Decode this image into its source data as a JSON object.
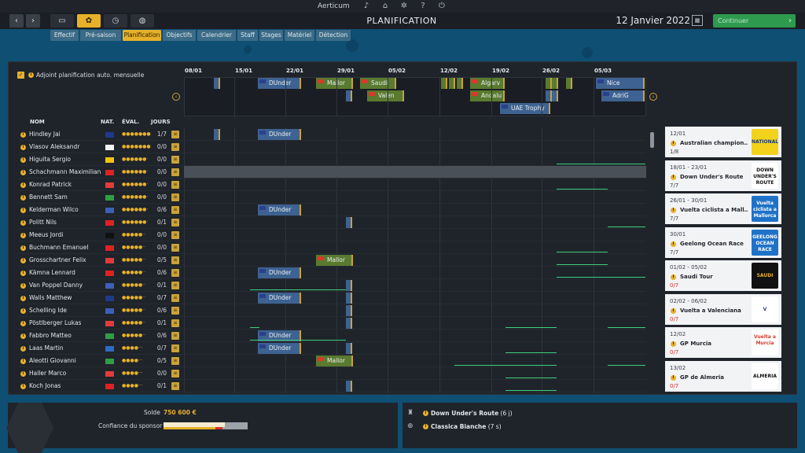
{
  "app": {
    "title": "Aerticum"
  },
  "header": {
    "page_title": "PLANIFICATION",
    "date": "12 Janvier 2022",
    "continue_label": "Continuer"
  },
  "tabs": [
    {
      "label": "Effectif"
    },
    {
      "label": "Pré-saison"
    },
    {
      "label": "Planification"
    },
    {
      "label": "Objectifs"
    },
    {
      "label": "Calendrier"
    },
    {
      "label": "Staff"
    },
    {
      "label": "Stages"
    },
    {
      "label": "Matériel"
    },
    {
      "label": "Détection"
    }
  ],
  "active_tab": "Planification",
  "auto_plan": {
    "label": "Adjoint planification auto. mensuelle",
    "checked": true
  },
  "timeline": {
    "weeks": [
      "08/01",
      "15/01",
      "22/01",
      "29/01",
      "05/02",
      "12/02",
      "19/02",
      "26/02",
      "05/03"
    ],
    "races": [
      {
        "name": "DUnder"
      },
      {
        "name": "Mallor"
      },
      {
        "name": "Saudi"
      },
      {
        "name": "Valen"
      },
      {
        "name": "Algarv"
      },
      {
        "name": "Andalu"
      },
      {
        "name": "UAE Trophy"
      },
      {
        "name": "Nice"
      },
      {
        "name": "AdriG"
      }
    ]
  },
  "columns": {
    "name": "NOM",
    "nat": "NAT.",
    "eval": "ÉVAL.",
    "days": "JOURS"
  },
  "riders": [
    {
      "name": "Hindley Jai",
      "days": "1/7",
      "stars": 7
    },
    {
      "name": "Vlasov Aleksandr",
      "days": "0/0",
      "stars": 7
    },
    {
      "name": "Higuita Sergio",
      "days": "0/0",
      "stars": 6
    },
    {
      "name": "Schachmann Maximilian",
      "days": "0/0",
      "stars": 6
    },
    {
      "name": "Konrad Patrick",
      "days": "0/0",
      "stars": 6
    },
    {
      "name": "Bennett Sam",
      "days": "0/0",
      "stars": 6
    },
    {
      "name": "Kelderman Wilco",
      "days": "0/6",
      "stars": 6
    },
    {
      "name": "Politt Nils",
      "days": "0/1",
      "stars": 6
    },
    {
      "name": "Meeus Jordi",
      "days": "0/0",
      "stars": 5
    },
    {
      "name": "Buchmann Emanuel",
      "days": "0/0",
      "stars": 5
    },
    {
      "name": "Grosschartner Felix",
      "days": "0/5",
      "stars": 5
    },
    {
      "name": "Kämna Lennard",
      "days": "0/6",
      "stars": 5
    },
    {
      "name": "Van Poppel Danny",
      "days": "0/1",
      "stars": 5
    },
    {
      "name": "Walls Matthew",
      "days": "0/7",
      "stars": 5
    },
    {
      "name": "Schelling Ide",
      "days": "0/6",
      "stars": 5
    },
    {
      "name": "Pöstlberger Lukas",
      "days": "0/1",
      "stars": 5
    },
    {
      "name": "Fabbro Matteo",
      "days": "0/6",
      "stars": 5
    },
    {
      "name": "Laas Martin",
      "days": "0/7",
      "stars": 4
    },
    {
      "name": "Aleotti Giovanni",
      "days": "0/5",
      "stars": 4
    },
    {
      "name": "Haller Marco",
      "days": "0/0",
      "stars": 4
    },
    {
      "name": "Koch Jonas",
      "days": "0/1",
      "stars": 4
    }
  ],
  "right_races": [
    {
      "dates": "12/01",
      "name": "Australian champion…",
      "count": "1/8",
      "count_red": false,
      "logo": "NATIONAL"
    },
    {
      "dates": "18/01 - 23/01",
      "name": "Down Under's Route",
      "count": "7/7",
      "count_red": false,
      "logo": "DOWN UNDER'S ROUTE"
    },
    {
      "dates": "26/01 - 30/01",
      "name": "Vuelta ciclista a Mall…",
      "count": "7/7",
      "count_red": false,
      "logo": "Vuelta ciclista a Mallorca"
    },
    {
      "dates": "30/01",
      "name": "Geelong Ocean Race",
      "count": "7/7",
      "count_red": false,
      "logo": "GEELONG OCEAN RACE"
    },
    {
      "dates": "01/02 - 05/02",
      "name": "Saudi Tour",
      "count": "0/7",
      "count_red": true,
      "logo": "SAUDI TOUR"
    },
    {
      "dates": "02/02 - 06/02",
      "name": "Vuelta a Valenciana",
      "count": "0/7",
      "count_red": true,
      "logo": "V"
    },
    {
      "dates": "12/02",
      "name": "GP Murcia",
      "count": "0/7",
      "count_red": true,
      "logo": "Vuelta a Murcia"
    },
    {
      "dates": "13/02",
      "name": "GP de Almeria",
      "count": "0/7",
      "count_red": true,
      "logo": "ALMERIA"
    }
  ],
  "finance": {
    "solde_label": "Solde",
    "solde_value": "750 600 €",
    "sponsor_label": "Confiance du sponsor",
    "sponsor_level": 0.73
  },
  "objectives": [
    {
      "race": "Down Under's Route",
      "detail": "(6 j)"
    },
    {
      "race": "Classica Bianche",
      "detail": "(7 s)"
    }
  ],
  "colors": {
    "accent": "#e7b02a",
    "continue": "#2e9a4e",
    "race_blue": "#3e6291",
    "race_green": "#5a7a2f",
    "plan_line": "#3fcf7a"
  }
}
